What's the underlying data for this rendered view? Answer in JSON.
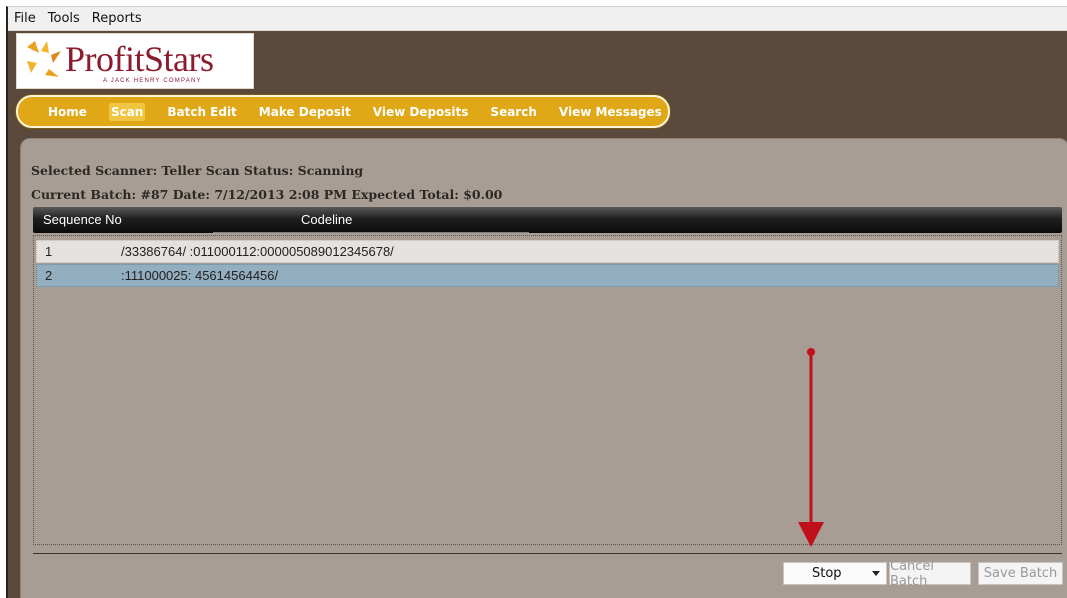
{
  "menu": {
    "items": [
      "File",
      "Tools",
      "Reports"
    ]
  },
  "logo": {
    "name": "ProfitStars",
    "tagline": "A JACK HENRY COMPANY"
  },
  "nav": {
    "items": [
      "Home",
      "Scan",
      "Batch Edit",
      "Make Deposit",
      "View Deposits",
      "Search",
      "View Messages"
    ],
    "active": "Scan"
  },
  "status": {
    "scanner_line": "Selected Scanner: Teller Scan  Status: Scanning",
    "batch_line": "Current Batch: #87 Date: 7/12/2013 2:08 PM Expected Total: $0.00"
  },
  "grid": {
    "columns": [
      "Sequence No",
      "Codeline"
    ],
    "rows": [
      {
        "seq": "1",
        "codeline": "/33386764/ :011000112:000005089012345678/"
      },
      {
        "seq": "2",
        "codeline": ":111000025: 45614564456/"
      }
    ],
    "selected_row": "2"
  },
  "actions": {
    "mode_select": "Stop",
    "cancel_label": "Cancel Batch",
    "save_label": "Save Batch"
  },
  "colors": {
    "frame": "#5b4a3c",
    "nav_bar": "#e0a817",
    "panel": "#a89d95",
    "selected_row": "#93aebf",
    "annotation_arrow": "#c0101a",
    "logo_text": "#8c1a2c"
  },
  "icons": {
    "logo_mark": "star-logo-icon",
    "dropdown": "chevron-down-icon"
  }
}
